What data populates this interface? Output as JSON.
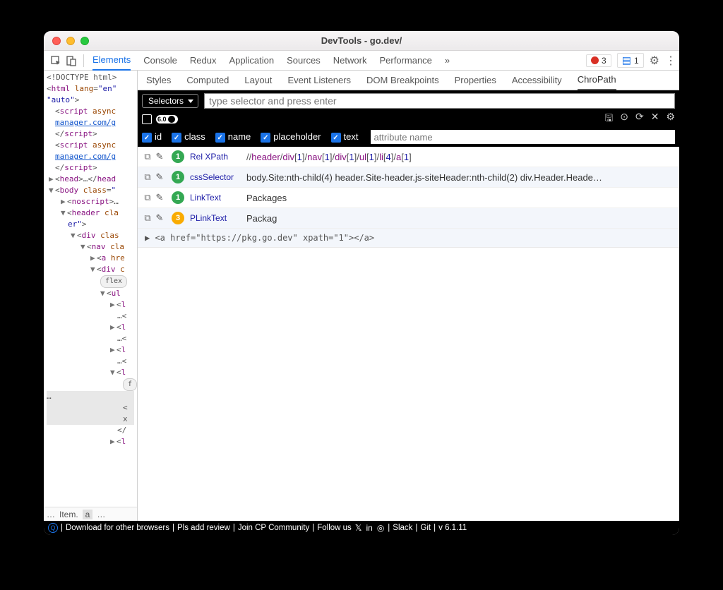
{
  "window": {
    "title": "DevTools - go.dev/"
  },
  "toolbar": {
    "tabs": [
      "Elements",
      "Console",
      "Redux",
      "Application",
      "Sources",
      "Network",
      "Performance"
    ],
    "active": "Elements",
    "more": "»",
    "errors": "3",
    "messages": "1"
  },
  "dom": {
    "l0": "<!DOCTYPE html>",
    "l1a": "<",
    "l1t": "html",
    "l1b": " lang",
    "l1c": "=",
    "l1d": "\"en\"",
    "l2": "\"auto\"",
    "l2b": ">",
    "l3a": "<",
    "l3t": "script",
    "l3b": " async",
    "l4": "manager.com/g",
    "l5a": "</",
    "l5t": "script",
    "l5b": ">",
    "l6a": "<",
    "l6t": "script",
    "l6b": " async",
    "l7": "manager.com/g",
    "l8a": "</",
    "l8t": "script",
    "l8b": ">",
    "l9a": "<",
    "l9t": "head",
    "l9b": ">…</",
    "l9t2": "head",
    "l10a": "<",
    "l10t": "body",
    "l10b": " class",
    "l10c": "=",
    "l10d": "\"",
    "l11a": "<",
    "l11t": "noscript",
    "l11b": ">…",
    "l12a": "<",
    "l12t": "header",
    "l12b": " cla",
    "l13": "er\"",
    "l13b": ">",
    "l14a": "<",
    "l14t": "div",
    "l14b": " clas",
    "l15a": "<",
    "l15t": "nav",
    "l15b": " cla",
    "l16a": "<",
    "l16t": "a",
    "l16b": " hre",
    "l17a": "<",
    "l17t": "div",
    "l17b": " c",
    "l18": "flex",
    "l19a": "<",
    "l19t": "ul",
    "l20a": "<",
    "l20t": "l",
    "l21": "…<",
    "l22a": "<",
    "l22t": "l",
    "l23": "…<",
    "l24a": "<",
    "l24t": "l",
    "l25": "…<",
    "l26a": "<",
    "l26t": "l",
    "l27": "f",
    "l28": "<",
    "l29": "x",
    "l30": "</",
    "l31a": "<",
    "l31t": "l"
  },
  "subtabs": [
    "Styles",
    "Computed",
    "Layout",
    "Event Listeners",
    "DOM Breakpoints",
    "Properties",
    "Accessibility",
    "ChroPath"
  ],
  "subtab_active": "ChroPath",
  "selectors_label": "Selectors",
  "selector_input_placeholder": "type selector and press enter",
  "ver_pill": "6.0",
  "filters": {
    "id": "id",
    "class": "class",
    "name": "name",
    "placeholder": "placeholder",
    "text": "text",
    "attr_placeholder": "attribute name"
  },
  "results": [
    {
      "count": "1",
      "color": "g",
      "label": "Rel XPath",
      "xpath_parts": [
        "//",
        "header",
        "/",
        "div",
        "[",
        "1",
        "]",
        "/",
        "nav",
        "[",
        "1",
        "]",
        "/",
        "div",
        "[",
        "1",
        "]",
        "/",
        "ul",
        "[",
        "1",
        "]",
        "/",
        "li",
        "[",
        "4",
        "]",
        "/",
        "a",
        "[",
        "1",
        "]"
      ]
    },
    {
      "count": "1",
      "color": "g",
      "label": "cssSelector",
      "value": "body.Site:nth-child(4) header.Site-header.js-siteHeader:nth-child(2) div.Header.Heade…"
    },
    {
      "count": "1",
      "color": "g",
      "label": "LinkText",
      "value": "Packages"
    },
    {
      "count": "3",
      "color": "o",
      "label": "PLinkText",
      "value": "Packag"
    }
  ],
  "linkout": "<a href=\"https://pkg.go.dev\" xpath=\"1\"></a>",
  "crumbs": {
    "a": "…",
    "b": "Item.",
    "c": "a",
    "d": "…"
  },
  "footer": {
    "dl": "Download for other browsers",
    "rev": "Pls add review",
    "join": "Join CP Community",
    "follow": "Follow us",
    "slack": "Slack",
    "git": "Git",
    "ver": "v 6.1.11"
  }
}
